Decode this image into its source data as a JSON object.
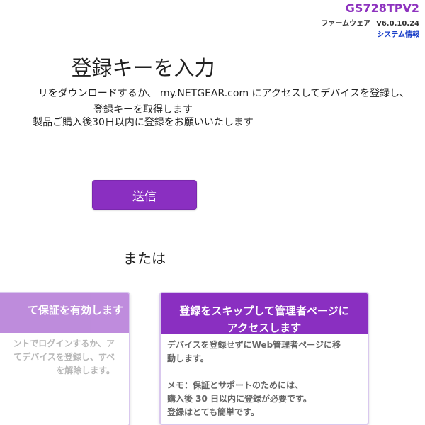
{
  "header": {
    "model": "GS728TPV2",
    "firmware_label": "ファームウェア",
    "firmware_version": "V6.0.10.24",
    "system_info_link": "システム情報"
  },
  "main": {
    "title": "登録キーを入力",
    "description_lines": [
      "リをダウンロードするか、 my.NETGEAR.com にアクセスしてデバイスを登録し、",
      "登録キーを取得します",
      "製品ご購入後30日以内に登録をお願いいたします"
    ],
    "key_input": {
      "value": "",
      "placeholder": ""
    },
    "send_button": "送信",
    "or_label": "または"
  },
  "cards": {
    "left": {
      "title": "て保証を有効します",
      "body_lines": [
        "ントでログインするか、ア",
        "てデバイスを登録し、すべ",
        "を解除します。"
      ]
    },
    "right": {
      "title_lines": [
        "登録をスキップして管理者ページに",
        "アクセスします"
      ],
      "body_lines_1": [
        "デバイスを登録せずにWeb管理者ページに移",
        "動します。"
      ],
      "body_lines_2": [
        "メモ：保証とサポートのためには、",
        "購入後 30 日以内に登録が必要です。",
        "登録はとても簡単です。"
      ]
    }
  },
  "colors": {
    "accent": "#8a2fc1",
    "model_text": "#8e33bf",
    "link": "#1a3fc8"
  }
}
